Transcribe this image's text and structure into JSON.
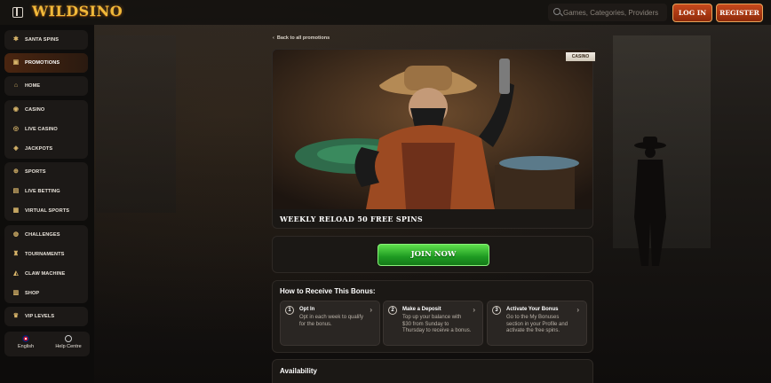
{
  "header": {
    "logo": "WILDSINO",
    "search_placeholder": "Games, Categories, Providers",
    "login_label": "LOG IN",
    "register_label": "REGISTER"
  },
  "sidebar": {
    "groups": [
      [
        {
          "label": "SANTA SPINS",
          "icon": "snowflake-icon"
        }
      ],
      [
        {
          "label": "PROMOTIONS",
          "icon": "gift-icon",
          "active": true
        }
      ],
      [
        {
          "label": "HOME",
          "icon": "home-icon"
        }
      ],
      [
        {
          "label": "CASINO",
          "icon": "casino-chip-icon"
        },
        {
          "label": "LIVE CASINO",
          "icon": "live-casino-icon"
        },
        {
          "label": "JACKPOTS",
          "icon": "jackpot-icon"
        }
      ],
      [
        {
          "label": "SPORTS",
          "icon": "sports-ball-icon"
        },
        {
          "label": "LIVE BETTING",
          "icon": "live-betting-icon"
        },
        {
          "label": "VIRTUAL SPORTS",
          "icon": "virtual-sports-icon"
        }
      ],
      [
        {
          "label": "CHALLENGES",
          "icon": "challenges-icon"
        },
        {
          "label": "TOURNAMENTS",
          "icon": "trophy-icon"
        },
        {
          "label": "CLAW MACHINE",
          "icon": "claw-icon"
        },
        {
          "label": "SHOP",
          "icon": "shop-icon"
        }
      ],
      [
        {
          "label": "VIP LEVELS",
          "icon": "vip-icon"
        }
      ]
    ],
    "footer": {
      "language_label": "English",
      "help_label": "Help Centre"
    }
  },
  "main": {
    "back_label": "Back to all promotions",
    "badge": "CASINO",
    "promo_title": "WEEKLY RELOAD 50 FREE SPINS",
    "join_label": "JOIN NOW",
    "how_title": "How to Receive This Bonus:",
    "steps": [
      {
        "num": "1",
        "title": "Opt In",
        "desc": "Opt in each week to qualify for the bonus."
      },
      {
        "num": "2",
        "title": "Make a Deposit",
        "desc": "Top up your balance with $30 from Sunday to Thursday to receive a bonus."
      },
      {
        "num": "3",
        "title": "Activate Your Bonus",
        "desc": "Go to the My Bonuses section in your Profile and activate the free spins."
      }
    ],
    "availability_title": "Availability"
  }
}
